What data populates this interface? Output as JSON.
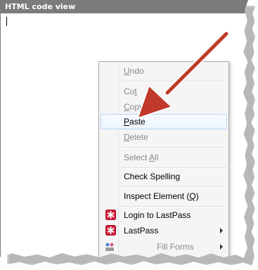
{
  "editor": {
    "title": "HTML code view"
  },
  "context_menu": {
    "items": [
      {
        "pre": "",
        "accel": "U",
        "post": "ndo",
        "state": "disabled"
      },
      {
        "pre": "Cu",
        "accel": "t",
        "post": "",
        "state": "disabled"
      },
      {
        "pre": "",
        "accel": "C",
        "post": "opy",
        "state": "disabled"
      },
      {
        "pre": "",
        "accel": "P",
        "post": "aste",
        "state": "highlighted"
      },
      {
        "pre": "",
        "accel": "D",
        "post": "elete",
        "state": "disabled"
      },
      {
        "pre": "Select ",
        "accel": "A",
        "post": "ll",
        "state": "disabled"
      },
      {
        "pre": "Check Spelling",
        "accel": "",
        "post": "",
        "state": "enabled"
      },
      {
        "pre": "Inspect Element (",
        "accel": "Q",
        "post": ")",
        "state": "enabled"
      },
      {
        "pre": "Login to LastPass",
        "accel": "",
        "post": "",
        "state": "enabled",
        "icon": "lastpass-icon"
      },
      {
        "pre": "LastPass",
        "accel": "",
        "post": "",
        "state": "enabled",
        "icon": "lastpass-icon",
        "submenu": true
      },
      {
        "pre": "Fill Forms",
        "accel": "",
        "post": "",
        "state": "disabled",
        "icon": "fill-forms-icon",
        "submenu": true
      }
    ]
  },
  "colors": {
    "header_bg": "#7b7b7b",
    "arrow": "#c0392b",
    "highlight_border": "#b9d7fb",
    "lastpass_red": "#d5213b"
  }
}
